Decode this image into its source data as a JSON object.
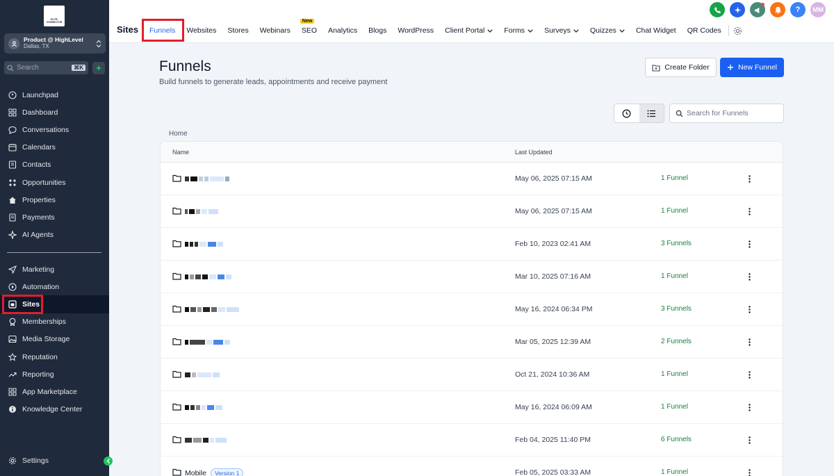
{
  "logo": {
    "text": "ELITE CONNECTOR"
  },
  "account": {
    "name": "Product @ HighLevel",
    "location": "Dallas, TX"
  },
  "sidebar_search": {
    "placeholder": "Search",
    "shortcut": "⌘K"
  },
  "sidebar": {
    "group1": [
      {
        "label": "Launchpad",
        "icon": "rocket-icon"
      },
      {
        "label": "Dashboard",
        "icon": "grid-icon"
      },
      {
        "label": "Conversations",
        "icon": "chat-icon"
      },
      {
        "label": "Calendars",
        "icon": "calendar-icon"
      },
      {
        "label": "Contacts",
        "icon": "contacts-icon"
      },
      {
        "label": "Opportunities",
        "icon": "opportunities-icon"
      },
      {
        "label": "Properties",
        "icon": "home-icon"
      },
      {
        "label": "Payments",
        "icon": "payments-icon"
      },
      {
        "label": "AI Agents",
        "icon": "sparkle-icon"
      }
    ],
    "group2": [
      {
        "label": "Marketing",
        "icon": "send-icon"
      },
      {
        "label": "Automation",
        "icon": "automation-icon"
      },
      {
        "label": "Sites",
        "icon": "sites-icon",
        "active": true
      },
      {
        "label": "Memberships",
        "icon": "badge-icon"
      },
      {
        "label": "Media Storage",
        "icon": "image-icon"
      },
      {
        "label": "Reputation",
        "icon": "star-icon"
      },
      {
        "label": "Reporting",
        "icon": "trend-icon"
      },
      {
        "label": "App Marketplace",
        "icon": "apps-icon"
      },
      {
        "label": "Knowledge Center",
        "icon": "info-icon"
      }
    ],
    "settings_label": "Settings"
  },
  "topbar": {
    "title": "Sites",
    "tabs": [
      {
        "label": "Funnels",
        "active": true
      },
      {
        "label": "Websites"
      },
      {
        "label": "Stores"
      },
      {
        "label": "Webinars"
      },
      {
        "label": "SEO",
        "badge": "New"
      },
      {
        "label": "Analytics"
      },
      {
        "label": "Blogs"
      },
      {
        "label": "WordPress"
      },
      {
        "label": "Client Portal",
        "dropdown": true
      },
      {
        "label": "Forms",
        "dropdown": true
      },
      {
        "label": "Surveys",
        "dropdown": true
      },
      {
        "label": "Quizzes",
        "dropdown": true
      },
      {
        "label": "Chat Widget"
      },
      {
        "label": "QR Codes"
      }
    ],
    "avatar_initials": "MM"
  },
  "colors": {
    "accent": "#1a5ff2",
    "sidebar": "#1f2a3c",
    "success": "#15803d",
    "highlight": "#e11d2b"
  },
  "main": {
    "title": "Funnels",
    "subtitle": "Build funnels to generate leads, appointments and receive payment",
    "create_folder_label": "Create Folder",
    "new_funnel_label": "New Funnel",
    "search_placeholder": "Search for Funnels",
    "breadcrumb": "Home"
  },
  "table": {
    "headers": {
      "name": "Name",
      "updated": "Last Updated"
    },
    "rows": [
      {
        "updated": "May 06, 2025 07:15 AM",
        "count": "1 Funnel"
      },
      {
        "updated": "May 06, 2025 07:15 AM",
        "count": "1 Funnel"
      },
      {
        "updated": "Feb 10, 2023 02:41 AM",
        "count": "3 Funnels"
      },
      {
        "updated": "Mar 10, 2025 07:16 AM",
        "count": "1 Funnel"
      },
      {
        "updated": "May 16, 2024 06:34 PM",
        "count": "3 Funnels"
      },
      {
        "updated": "Mar 05, 2025 12:39 AM",
        "count": "2 Funnels"
      },
      {
        "updated": "Oct 21, 2024 10:36 AM",
        "count": "1 Funnel"
      },
      {
        "updated": "May 16, 2024 06:09 AM",
        "count": "1 Funnel"
      },
      {
        "updated": "Feb 04, 2025 11:40 PM",
        "count": "6 Funnels"
      },
      {
        "name": "Mobile",
        "badge": "Version 1",
        "updated": "Feb 05, 2025 03:33 AM",
        "count": "1 Funnel"
      }
    ]
  }
}
